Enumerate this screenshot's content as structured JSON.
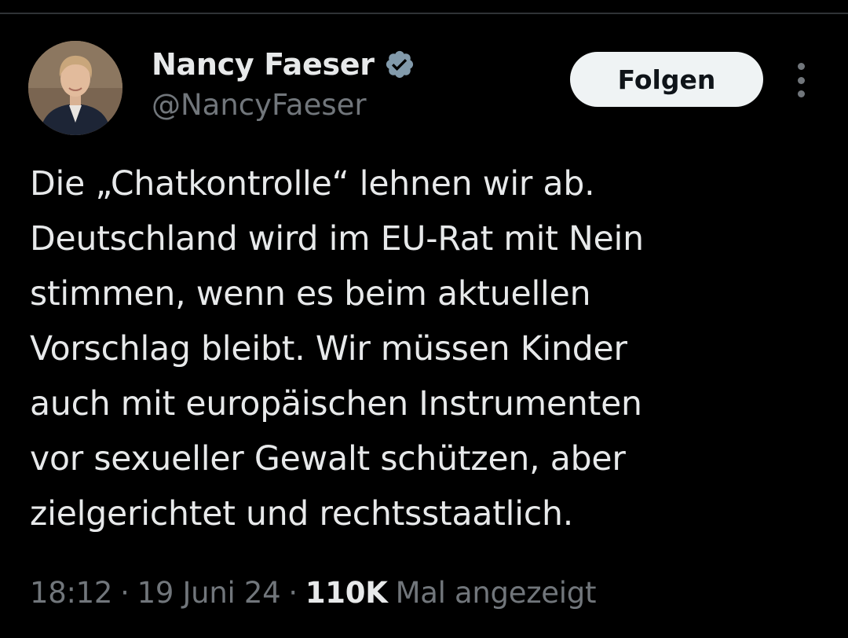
{
  "author": {
    "display_name": "Nancy Faeser",
    "handle": "@NancyFaeser",
    "verified": true,
    "avatar_icon": "profile-photo"
  },
  "actions": {
    "follow_label": "Folgen",
    "more_icon": "more-vertical-icon"
  },
  "tweet": {
    "text": "Die „Chatkontrolle“ lehnen wir ab.\nDeutschland wird im EU-Rat mit Nein\nstimmen, wenn es beim aktuellen\nVorschlag bleibt. Wir müssen Kinder\nauch mit europäischen Instrumenten\nvor sexueller Gewalt schützen, aber\nzielgerichtet und rechtsstaatlich."
  },
  "meta": {
    "time": "18:12",
    "separator": "·",
    "date": "19 Juni 24",
    "views_count": "110K",
    "views_label": "Mal angezeigt"
  },
  "colors": {
    "background": "#000000",
    "primary_text": "#e7e9ea",
    "secondary_text": "#71767b",
    "follow_button_bg": "#eff3f4",
    "verified_badge": "#829aab"
  }
}
